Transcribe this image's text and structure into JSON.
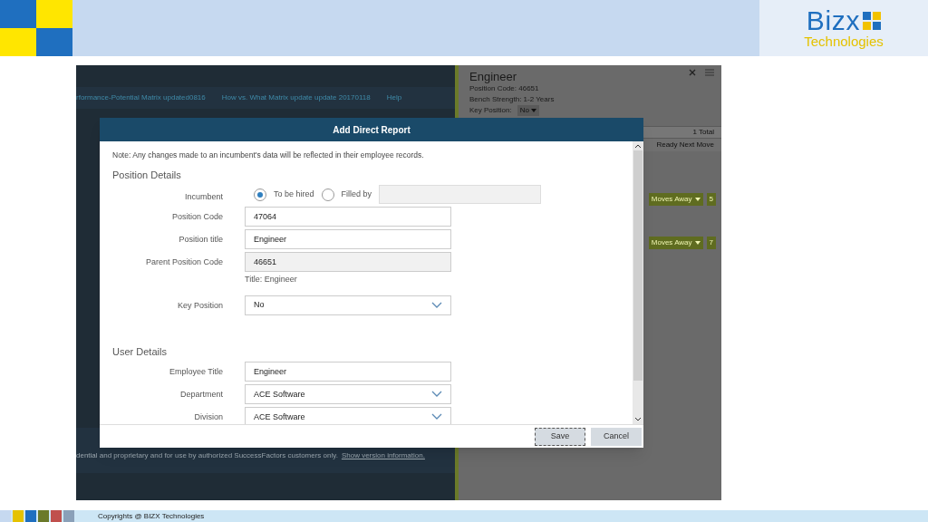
{
  "slide_header": {
    "logo_word": "Bizx",
    "logo_tagline": "Technologies"
  },
  "app": {
    "nav_links": [
      "rformance-Potential Matrix updated0816",
      "How vs. What Matrix update update 20170118",
      "Help"
    ],
    "footer_text": "dential and proprietary and for use by authorized SuccessFactors customers only.",
    "footer_link": "Show version information.",
    "side_panel": {
      "title": "Engineer",
      "lines": [
        "Position Code: 46651",
        "Bench Strength: 1-2 Years"
      ],
      "key_label": "Key Position:",
      "key_value": "No",
      "total": "1 Total",
      "column": "Ready Next Move",
      "badges": [
        {
          "label": "Moves Away",
          "count": "5"
        },
        {
          "label": "Moves Away",
          "count": "7"
        }
      ]
    }
  },
  "dialog": {
    "title": "Add Direct Report",
    "note": "Note: Any changes made to an incumbent's data will be reflected in their employee records.",
    "sections": [
      {
        "heading": "Position Details",
        "rows": [
          {
            "kind": "radio",
            "label": "Incumbent",
            "options": [
              {
                "label": "To be hired",
                "selected": true
              },
              {
                "label": "Filled by",
                "selected": false
              }
            ]
          },
          {
            "kind": "text",
            "label": "Position Code",
            "value": "47064"
          },
          {
            "kind": "text",
            "label": "Position title",
            "value": "Engineer"
          },
          {
            "kind": "readonly",
            "label": "Parent Position Code",
            "value": "46651",
            "hint": "Title: Engineer"
          },
          {
            "kind": "select",
            "label": "Key Position",
            "value": "No"
          }
        ]
      },
      {
        "heading": "User Details",
        "rows": [
          {
            "kind": "text",
            "label": "Employee Title",
            "value": "Engineer"
          },
          {
            "kind": "select",
            "label": "Department",
            "value": "ACE Software"
          },
          {
            "kind": "select",
            "label": "Division",
            "value": "ACE Software"
          }
        ]
      }
    ],
    "buttons": [
      {
        "label": "Save",
        "focused": true
      },
      {
        "label": "Cancel",
        "focused": false
      }
    ]
  },
  "slide_footer": {
    "text": "Copyrights @ BIZX Technologies"
  }
}
